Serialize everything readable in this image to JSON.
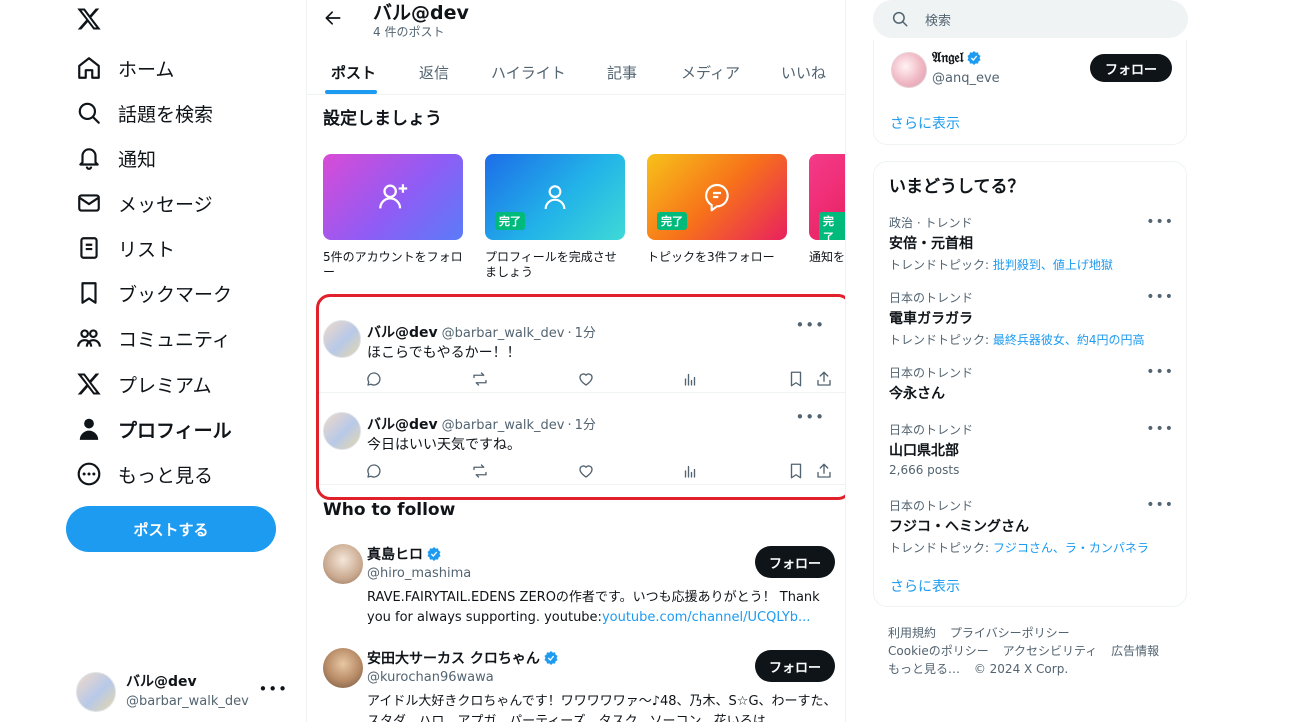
{
  "nav": {
    "items": [
      {
        "label": "ホーム",
        "icon": "home-icon"
      },
      {
        "label": "話題を検索",
        "icon": "search-icon"
      },
      {
        "label": "通知",
        "icon": "bell-icon"
      },
      {
        "label": "メッセージ",
        "icon": "mail-icon"
      },
      {
        "label": "リスト",
        "icon": "list-icon"
      },
      {
        "label": "ブックマーク",
        "icon": "bookmark-icon"
      },
      {
        "label": "コミュニティ",
        "icon": "community-icon"
      },
      {
        "label": "プレミアム",
        "icon": "x-logo-icon"
      },
      {
        "label": "プロフィール",
        "icon": "person-icon"
      },
      {
        "label": "もっと見る",
        "icon": "more-circle-icon"
      }
    ],
    "post_button": "ポストする",
    "account": {
      "name": "バル@dev",
      "handle": "@barbar_walk_dev"
    }
  },
  "profile": {
    "name": "バル@dev",
    "post_count": "4 件のポスト"
  },
  "tabs": [
    "ポスト",
    "返信",
    "ハイライト",
    "記事",
    "メディア",
    "いいね"
  ],
  "setup": {
    "title": "設定しましょう",
    "done_label": "完了",
    "cards": [
      {
        "label": "5件のアカウントをフォロー",
        "done": false
      },
      {
        "label": "プロフィールを完成させましょう",
        "done": true
      },
      {
        "label": "トピックを3件フォロー",
        "done": true
      },
      {
        "label": "通知を",
        "done": true
      }
    ]
  },
  "tweets": [
    {
      "name": "バル@dev",
      "handle": "@barbar_walk_dev",
      "time": "1分",
      "text": "ほこらでもやるかー！！"
    },
    {
      "name": "バル@dev",
      "handle": "@barbar_walk_dev",
      "time": "1分",
      "text": "今日はいい天気ですね。"
    }
  ],
  "who_to_follow": {
    "title": "Who to follow",
    "follow_label": "フォロー",
    "users": [
      {
        "name": "真島ヒロ",
        "handle": "@hiro_mashima",
        "bio": "RAVE.FAIRYTAIL.EDENS ZEROの作者です。いつも応援ありがとう！ Thank you for always supporting. youtube:",
        "link": "youtube.com/channel/UCQLYb..."
      },
      {
        "name": "安田大サーカス クロちゃん",
        "handle": "@kurochan96wawa",
        "bio": "アイドル大好きクロちゃんです！ワワワワワァ〜♪48、乃木、S☆G、わーすた、スタダ、ハロ、アプガ、パーティーズ、タスク、ソーコン、花いろは"
      }
    ]
  },
  "search": {
    "placeholder": "検索"
  },
  "suggested": {
    "name": "𝔄𝔫𝔤𝔢𝔩",
    "handle": "@anq_eve",
    "follow_label": "フォロー",
    "show_more": "さらに表示"
  },
  "trends": {
    "title": "いまどうしてる？",
    "show_more": "さらに表示",
    "items": [
      {
        "context": "政治 · トレンド",
        "name": "安倍・元首相",
        "sub_prefix": "トレンドトピック: ",
        "sub_links": "批判殺到、値上げ地獄"
      },
      {
        "context": "日本のトレンド",
        "name": "電車ガラガラ",
        "sub_prefix": "トレンドトピック: ",
        "sub_links": "最終兵器彼女、約4円の円高"
      },
      {
        "context": "日本のトレンド",
        "name": "今永さん",
        "sub_prefix": "",
        "sub_links": ""
      },
      {
        "context": "日本のトレンド",
        "name": "山口県北部",
        "sub_prefix": "2,666 posts",
        "sub_links": ""
      },
      {
        "context": "日本のトレンド",
        "name": "フジコ・ヘミングさん",
        "sub_prefix": "トレンドトピック: ",
        "sub_links": "フジコさん、ラ・カンパネラ"
      }
    ]
  },
  "footer": [
    "利用規約",
    "プライバシーポリシー",
    "Cookieのポリシー",
    "アクセシビリティ",
    "広告情報",
    "もっと見る…",
    "© 2024 X Corp."
  ],
  "colors": {
    "accent": "#1d9bf0",
    "done_badge": "#00ba7c",
    "highlight": "#e0202b",
    "text": "#0f1419",
    "secondary": "#536471"
  }
}
